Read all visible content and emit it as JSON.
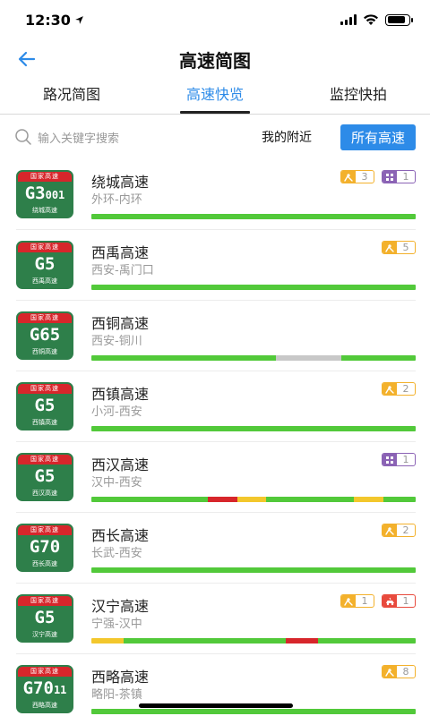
{
  "status": {
    "time": "12:30"
  },
  "nav": {
    "title": "高速简图"
  },
  "tabs": [
    {
      "label": "路况简图",
      "active": false
    },
    {
      "label": "高速快览",
      "active": true
    },
    {
      "label": "监控快拍",
      "active": false
    }
  ],
  "search": {
    "placeholder": "输入关键字搜索",
    "nearby": "我的附近",
    "all_button": "所有高速"
  },
  "colors": {
    "accent": "#2d8be8",
    "smooth": "#52c93a",
    "slow": "#f3c72c",
    "jam": "#d7262b",
    "no_data": "#c8c8c8",
    "shield_green": "#2e7f4a",
    "shield_red": "#d7262b"
  },
  "highways": [
    {
      "shield_top": "国家高速",
      "code": "G3",
      "code_sub": "001",
      "shield_bottom": "绕城高速",
      "name": "绕城高速",
      "route": "外环-内环",
      "badges": [
        {
          "type": "construction",
          "icon": "construction-icon",
          "count": "3"
        },
        {
          "type": "control",
          "icon": "control-icon",
          "count": "1"
        }
      ],
      "traffic": [
        {
          "status": "smooth",
          "share": 1.0
        }
      ]
    },
    {
      "shield_top": "国家高速",
      "code": "G5",
      "code_sub": "",
      "shield_bottom": "西禹高速",
      "name": "西禹高速",
      "route": "西安-禹门口",
      "badges": [
        {
          "type": "construction",
          "icon": "construction-icon",
          "count": "5"
        }
      ],
      "traffic": [
        {
          "status": "smooth",
          "share": 1.0
        }
      ]
    },
    {
      "shield_top": "国家高速",
      "code": "G65",
      "code_sub": "",
      "shield_bottom": "西铜高速",
      "name": "西铜高速",
      "route": "西安-铜川",
      "badges": [],
      "traffic": [
        {
          "status": "smooth",
          "share": 0.57
        },
        {
          "status": "no_data",
          "share": 0.2
        },
        {
          "status": "smooth",
          "share": 0.23
        }
      ]
    },
    {
      "shield_top": "国家高速",
      "code": "G5",
      "code_sub": "",
      "shield_bottom": "西镇高速",
      "name": "西镇高速",
      "route": "小河-西安",
      "badges": [
        {
          "type": "construction",
          "icon": "construction-icon",
          "count": "2"
        }
      ],
      "traffic": [
        {
          "status": "smooth",
          "share": 1.0
        }
      ]
    },
    {
      "shield_top": "国家高速",
      "code": "G5",
      "code_sub": "",
      "shield_bottom": "西汉高速",
      "name": "西汉高速",
      "route": "汉中-西安",
      "badges": [
        {
          "type": "control",
          "icon": "control-icon",
          "count": "1"
        }
      ],
      "traffic": [
        {
          "status": "smooth",
          "share": 0.36
        },
        {
          "status": "jam",
          "share": 0.09
        },
        {
          "status": "slow",
          "share": 0.09
        },
        {
          "status": "smooth",
          "share": 0.27
        },
        {
          "status": "slow",
          "share": 0.09
        },
        {
          "status": "smooth",
          "share": 0.1
        }
      ]
    },
    {
      "shield_top": "国家高速",
      "code": "G70",
      "code_sub": "",
      "shield_bottom": "西长高速",
      "name": "西长高速",
      "route": "长武-西安",
      "badges": [
        {
          "type": "construction",
          "icon": "construction-icon",
          "count": "2"
        }
      ],
      "traffic": [
        {
          "status": "smooth",
          "share": 1.0
        }
      ]
    },
    {
      "shield_top": "国家高速",
      "code": "G5",
      "code_sub": "",
      "shield_bottom": "汉宁高速",
      "name": "汉宁高速",
      "route": "宁强-汉中",
      "badges": [
        {
          "type": "construction",
          "icon": "construction-icon",
          "count": "1"
        },
        {
          "type": "accident",
          "icon": "accident-icon",
          "count": "1"
        }
      ],
      "traffic": [
        {
          "status": "slow",
          "share": 0.1
        },
        {
          "status": "smooth",
          "share": 0.5
        },
        {
          "status": "jam",
          "share": 0.1
        },
        {
          "status": "smooth",
          "share": 0.3
        }
      ]
    },
    {
      "shield_top": "国家高速",
      "code": "G70",
      "code_sub": "11",
      "shield_bottom": "西略高速",
      "name": "西略高速",
      "route": "略阳-茶镇",
      "badges": [
        {
          "type": "construction",
          "icon": "construction-icon",
          "count": "8"
        }
      ],
      "traffic": [
        {
          "status": "smooth",
          "share": 1.0
        }
      ]
    }
  ]
}
